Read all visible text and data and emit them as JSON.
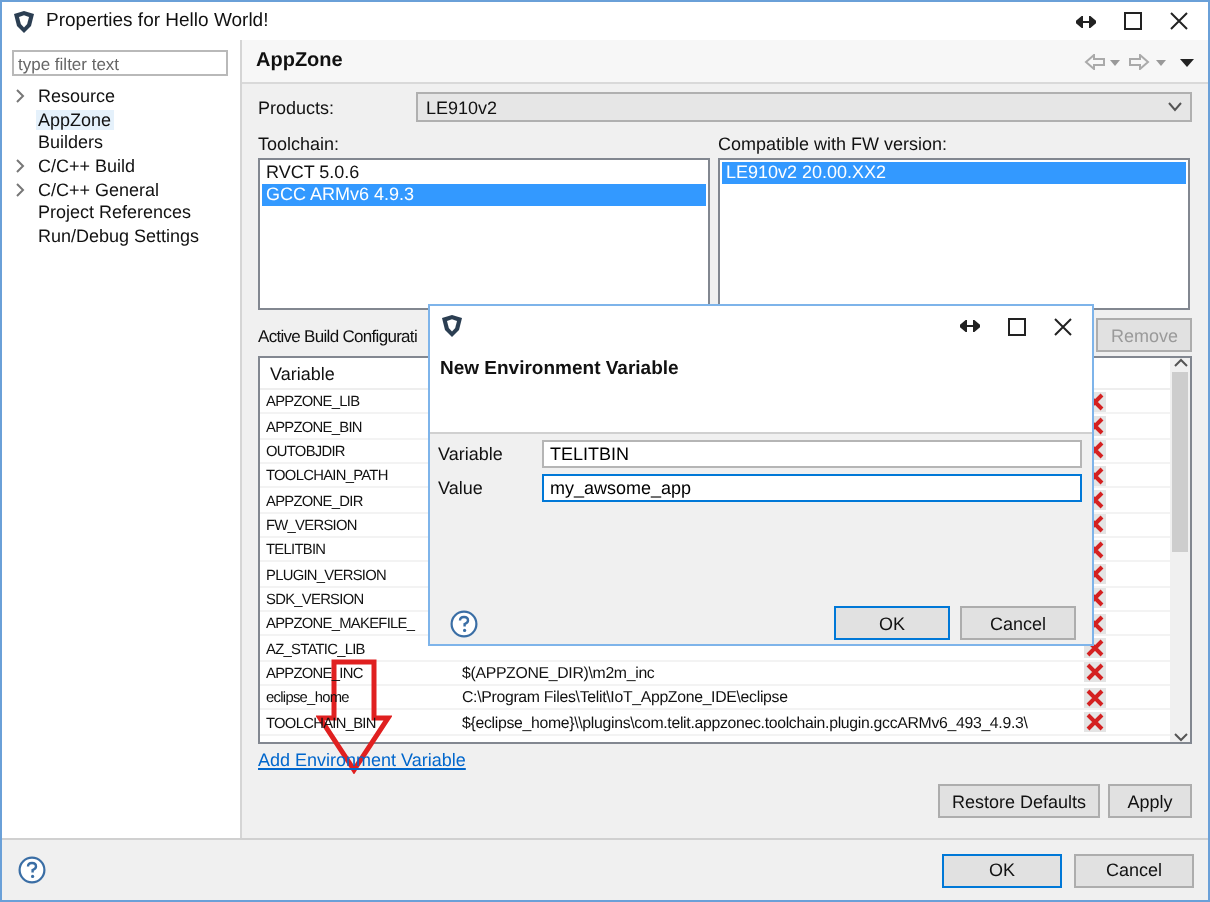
{
  "window": {
    "title": "Properties for Hello World!"
  },
  "filter": {
    "placeholder": "type filter text"
  },
  "tree": [
    {
      "label": "Resource",
      "kind": "group",
      "expanded": false,
      "selected": false
    },
    {
      "label": "AppZone",
      "kind": "page",
      "selected": true
    },
    {
      "label": "Builders",
      "kind": "page",
      "selected": false
    },
    {
      "label": "C/C++ Build",
      "kind": "group",
      "expanded": false,
      "selected": false
    },
    {
      "label": "C/C++ General",
      "kind": "group",
      "expanded": false,
      "selected": false
    },
    {
      "label": "Project References",
      "kind": "page",
      "selected": false
    },
    {
      "label": "Run/Debug Settings",
      "kind": "page",
      "selected": false
    }
  ],
  "page": {
    "title": "AppZone"
  },
  "products": {
    "label": "Products:",
    "value": "LE910v2"
  },
  "toolchain": {
    "label": "Toolchain:",
    "items": [
      {
        "label": "RVCT 5.0.6",
        "selected": false
      },
      {
        "label": "GCC ARMv6 4.9.3",
        "selected": true
      }
    ]
  },
  "compatible": {
    "label": "Compatible with FW version:",
    "items": [
      {
        "label": "LE910v2 20.00.XX2",
        "selected": true
      }
    ]
  },
  "build_config": {
    "label": "Active Build Configurati",
    "buttons": [
      {
        "label": "Remove",
        "disabled": true
      }
    ]
  },
  "variables": {
    "columns": [
      "Variable"
    ],
    "rows": [
      {
        "variable": "APPZONE_LIB"
      },
      {
        "variable": "APPZONE_BIN"
      },
      {
        "variable": "OUTOBJDIR"
      },
      {
        "variable": "TOOLCHAIN_PATH"
      },
      {
        "variable": "APPZONE_DIR"
      },
      {
        "variable": "FW_VERSION"
      },
      {
        "variable": "TELITBIN"
      },
      {
        "variable": "PLUGIN_VERSION"
      },
      {
        "variable": "SDK_VERSION"
      },
      {
        "variable": "APPZONE_MAKEFILE_"
      },
      {
        "variable": "AZ_STATIC_LIB"
      },
      {
        "variable": "APPZONE_INC",
        "value": "$(APPZONE_DIR)\\m2m_inc"
      },
      {
        "variable": "eclipse_home",
        "value": "C:\\Program Files\\Telit\\IoT_AppZone_IDE\\eclipse"
      },
      {
        "variable": "TOOLCHAIN_BIN",
        "value": "${eclipse_home}\\\\plugins\\com.telit.appzonec.toolchain.plugin.gccARMv6_493_4.9.3\\"
      }
    ]
  },
  "add_link": "Add Environment Variable",
  "page_buttons": [
    {
      "label": "Restore Defaults"
    },
    {
      "label": "Apply"
    }
  ],
  "footer_buttons": [
    {
      "label": "OK",
      "default": true
    },
    {
      "label": "Cancel",
      "default": false
    }
  ],
  "dialog": {
    "title": "New Environment Variable",
    "fields": [
      {
        "label": "Variable",
        "value": "TELITBIN",
        "focused": false
      },
      {
        "label": "Value",
        "value": "my_awsome_app",
        "focused": true
      }
    ],
    "buttons": [
      {
        "label": "OK",
        "default": true
      },
      {
        "label": "Cancel",
        "default": false
      }
    ]
  }
}
